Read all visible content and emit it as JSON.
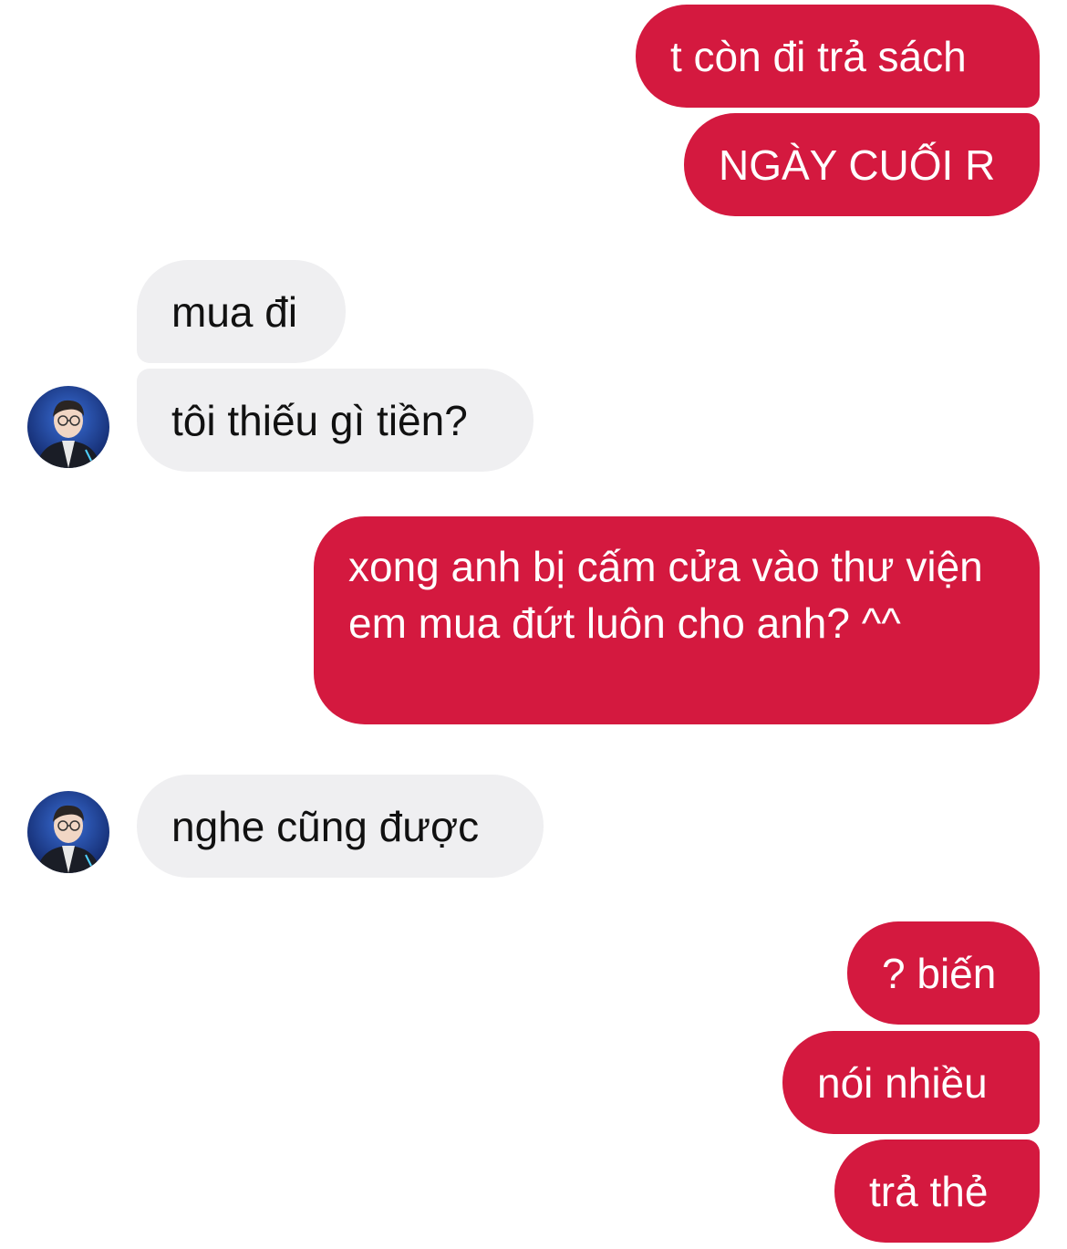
{
  "colors": {
    "outgoing_bubble": "#d4193f",
    "incoming_bubble": "#efeff1",
    "outgoing_text": "#ffffff",
    "incoming_text": "#111111"
  },
  "messages": [
    {
      "direction": "outgoing",
      "text": "t còn đi trả sách"
    },
    {
      "direction": "outgoing",
      "text": "NGÀY CUỐI R"
    },
    {
      "direction": "incoming",
      "text": "mua đi"
    },
    {
      "direction": "incoming",
      "text": "tôi thiếu gì tiền?",
      "avatar": "user-avatar"
    },
    {
      "direction": "outgoing",
      "text": "xong anh bị cấm cửa vào thư viện em mua đứt luôn cho anh? ^^"
    },
    {
      "direction": "incoming",
      "text": "nghe cũng được",
      "avatar": "user-avatar"
    },
    {
      "direction": "outgoing",
      "text": "? biến"
    },
    {
      "direction": "outgoing",
      "text": "nói nhiều"
    },
    {
      "direction": "outgoing",
      "text": "trả thẻ"
    }
  ]
}
